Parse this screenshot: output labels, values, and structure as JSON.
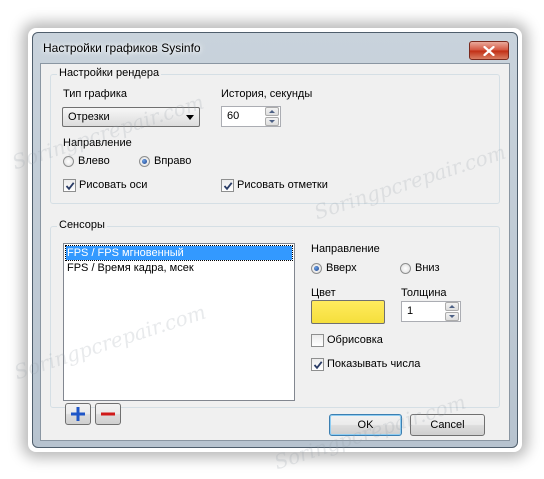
{
  "window": {
    "title": "Настройки графиков Sysinfo",
    "close_icon": "close-x-icon"
  },
  "render_settings": {
    "group_label": "Настройки рендера",
    "chart_type_label": "Тип графика",
    "chart_type_value": "Отрезки",
    "history_label": "История, секунды",
    "history_value": "60",
    "direction_label": "Направление",
    "dir_left": "Влево",
    "dir_right": "Вправо",
    "dir_selected": "right",
    "draw_axes_label": "Рисовать оси",
    "draw_axes_checked": true,
    "draw_marks_label": "Рисовать отметки",
    "draw_marks_checked": true
  },
  "sensors": {
    "group_label": "Сенсоры",
    "items": [
      "FPS / FPS мгновенный",
      "FPS / Время кадра, мсек"
    ],
    "selected_index": 0,
    "direction_label": "Направление",
    "dir_up": "Вверх",
    "dir_down": "Вниз",
    "dir_selected": "up",
    "color_label": "Цвет",
    "color_value": "#f7e34a",
    "thickness_label": "Толщина",
    "thickness_value": "1",
    "outline_label": "Обрисовка",
    "outline_checked": false,
    "show_numbers_label": "Показывать числа",
    "show_numbers_checked": true,
    "add_icon": "plus-icon",
    "remove_icon": "minus-icon"
  },
  "buttons": {
    "ok": "OK",
    "cancel": "Cancel"
  },
  "watermark": "Soringpcrepair.com"
}
